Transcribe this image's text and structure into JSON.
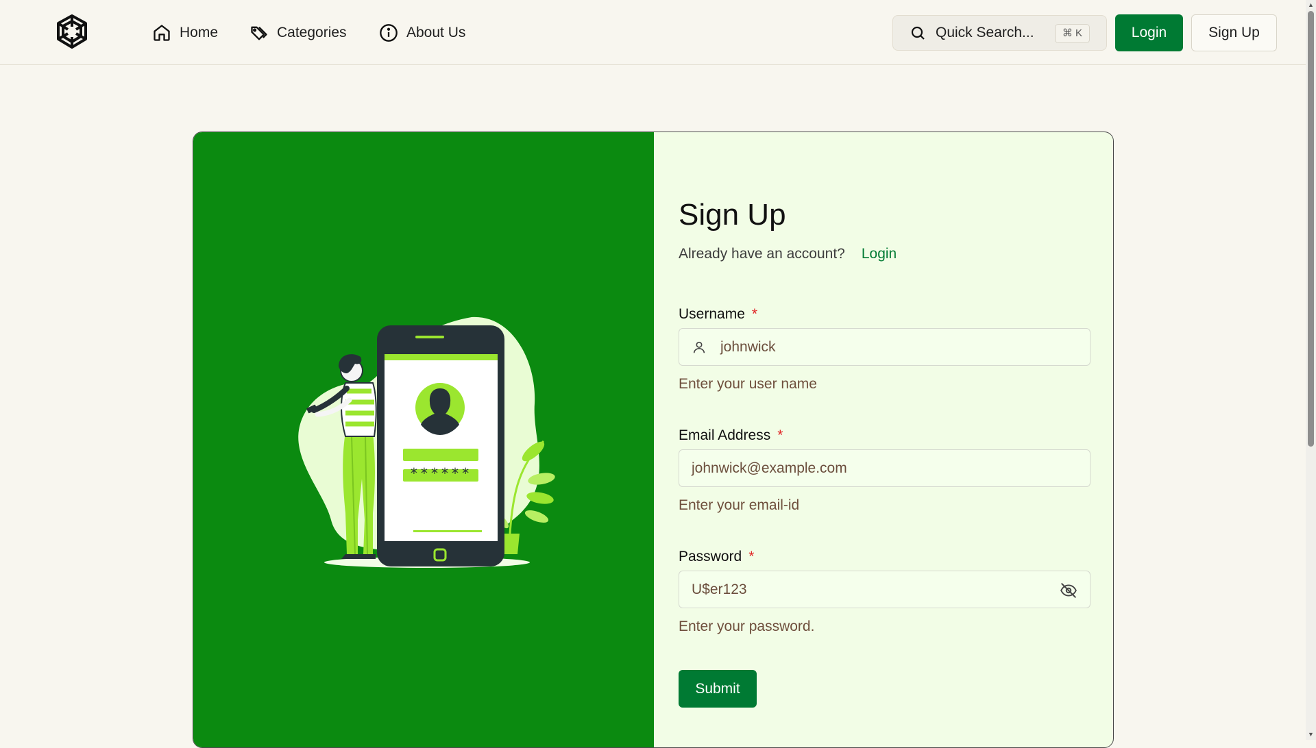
{
  "header": {
    "nav": [
      {
        "label": "Home",
        "icon": "home-icon"
      },
      {
        "label": "Categories",
        "icon": "tag-icon"
      },
      {
        "label": "About Us",
        "icon": "info-icon"
      }
    ],
    "search": {
      "placeholder": "Quick Search...",
      "shortcut": "⌘ K",
      "icon": "search-icon"
    },
    "login_label": "Login",
    "signup_label": "Sign Up"
  },
  "form": {
    "title": "Sign Up",
    "account_prompt": "Already have an account?",
    "login_link": "Login",
    "username": {
      "label": "Username",
      "required_mark": "*",
      "value": "johnwick",
      "help": "Enter your user name",
      "icon": "user-icon"
    },
    "email": {
      "label": "Email Address",
      "required_mark": "*",
      "value": "johnwick@example.com",
      "help": "Enter your email-id"
    },
    "password": {
      "label": "Password",
      "required_mark": "*",
      "value": "U$er123",
      "help": "Enter your password.",
      "icon": "eye-off-icon"
    },
    "submit_label": "Submit"
  },
  "illustration": {
    "password_mask": "******"
  },
  "colors": {
    "primary": "#007a33",
    "panel": "#0b8a10",
    "accent": "#9be62f",
    "background": "#f8f6ef"
  }
}
